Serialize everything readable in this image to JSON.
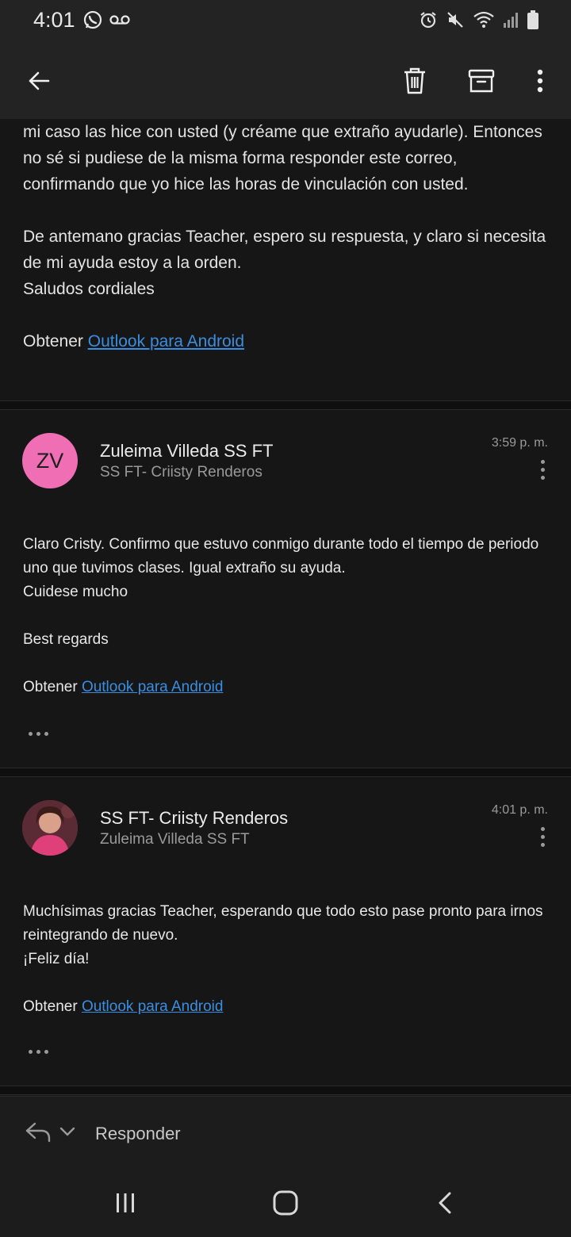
{
  "status": {
    "time": "4:01",
    "left_icons": [
      "whatsapp-icon",
      "voicemail-icon"
    ],
    "right_icons": [
      "alarm-icon",
      "mute-icon",
      "wifi-icon",
      "signal-icon",
      "battery-icon"
    ]
  },
  "toolbar": {
    "back_icon": "arrow-left-icon",
    "delete_icon": "trash-icon",
    "archive_icon": "archive-icon",
    "more_icon": "more-vertical-icon"
  },
  "prev_message": {
    "paragraph1": "mi caso las hice con usted (y créame que extraño ayudarle). Entonces no sé si pudiese de la misma forma responder este correo, confirmando que yo hice las horas de vinculación con usted.",
    "paragraph2_line1": "De antemano gracias Teacher, espero su respuesta, y claro si necesita de mi ayuda estoy a la orden.",
    "paragraph2_line2": "Saludos cordiales",
    "signature_prefix": "Obtener",
    "signature_link": "Outlook para Android"
  },
  "messages": [
    {
      "avatar_initials": "ZV",
      "avatar_color": "#f06fb4",
      "sender": "Zuleima Villeda SS FT",
      "recipient": "SS FT- Criisty Renderos",
      "time": "3:59 p. m.",
      "line1": "Claro Cristy. Confirmo que estuvo conmigo durante todo el tiempo de periodo uno que tuvimos clases. Igual extraño su ayuda.",
      "line2": "Cuidese mucho",
      "line3": "Best regards",
      "signature_prefix": "Obtener",
      "signature_link": "Outlook para Android"
    },
    {
      "avatar_initials": "",
      "avatar_color": "#c2185b",
      "sender": "SS FT- Criisty Renderos",
      "recipient": "Zuleima Villeda SS FT",
      "time": "4:01 p. m.",
      "line1": "Muchísimas gracias Teacher, esperando que todo esto pase pronto para irnos reintegrando de nuevo.",
      "line2": "¡Feliz día!",
      "signature_prefix": "Obtener",
      "signature_link": "Outlook para Android"
    }
  ],
  "reply": {
    "label": "Responder",
    "reply_icon": "reply-icon",
    "chevron_icon": "chevron-down-icon"
  },
  "navbar": {
    "recents_icon": "recents-icon",
    "home_icon": "home-icon",
    "back_icon": "nav-back-icon"
  }
}
